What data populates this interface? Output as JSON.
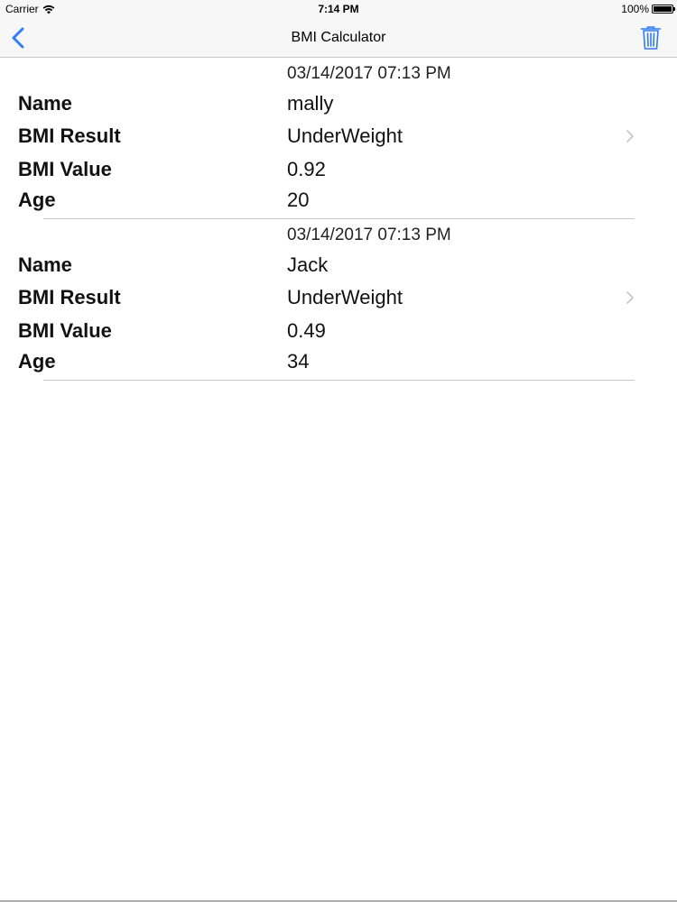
{
  "status_bar": {
    "carrier": "Carrier",
    "time": "7:14 PM",
    "battery": "100%"
  },
  "nav": {
    "title": "BMI Calculator",
    "back_icon": "chevron-left-icon",
    "trash_icon": "trash-icon"
  },
  "colors": {
    "accent": "#2f7cf6",
    "separator": "#c8c7cc",
    "nav_background": "#f7f7f7"
  },
  "labels": {
    "name": "Name",
    "bmi_result": "BMI Result",
    "bmi_value": "BMI Value",
    "age": "Age"
  },
  "records": [
    {
      "date": "03/14/2017  07:13 PM",
      "name": "mally",
      "bmi_result": "UnderWeight",
      "bmi_value": "0.92",
      "age": "20"
    },
    {
      "date": "03/14/2017  07:13 PM",
      "name": "Jack",
      "bmi_result": "UnderWeight",
      "bmi_value": "0.49",
      "age": "34"
    }
  ]
}
